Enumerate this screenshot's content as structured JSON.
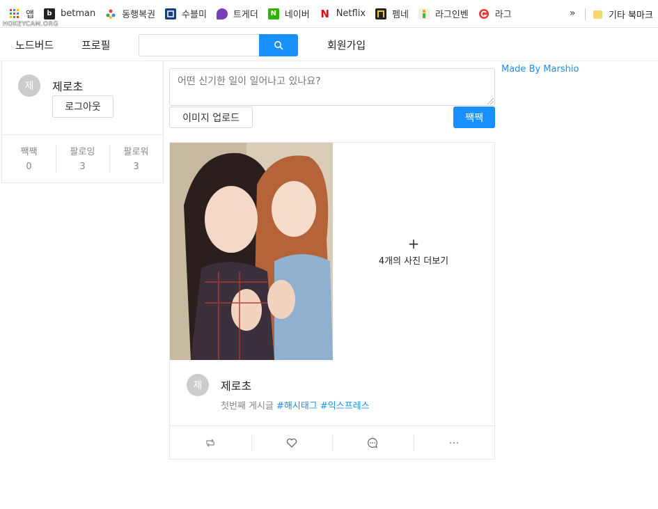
{
  "bookmarks": {
    "items": [
      {
        "label": "앱",
        "icon": "apps-grid-icon",
        "color": "#e94235"
      },
      {
        "label": "betman",
        "icon": "betman-icon",
        "color": "#222222"
      },
      {
        "label": "동행복권",
        "icon": "lottery-icon",
        "color": "#e94235"
      },
      {
        "label": "수블미",
        "icon": "sublime-icon",
        "color": "#1a3a8a"
      },
      {
        "label": "트게더",
        "icon": "twitch-icon",
        "color": "#7b3fb5"
      },
      {
        "label": "네이버",
        "icon": "naver-icon",
        "color": "#2db400"
      },
      {
        "label": "Netflix",
        "icon": "netflix-icon",
        "color": "#e50914"
      },
      {
        "label": "펨네",
        "icon": "fmkorea-icon",
        "color": "#222222"
      },
      {
        "label": "라그인벤",
        "icon": "inven-icon",
        "color": "#4caf50"
      },
      {
        "label": "라그",
        "icon": "ragnarok-icon",
        "color": "#e53935"
      }
    ],
    "overflow": "»",
    "other": "기타 북마크"
  },
  "watermark": "HOKEYCAM.ORG",
  "nav": {
    "home": "노드버드",
    "profile": "프로필",
    "search_value": "",
    "signup": "회원가입"
  },
  "profile": {
    "avatar": "제",
    "nickname": "제로초",
    "logout": "로그아웃",
    "stats": [
      {
        "label": "짹짹",
        "value": "0"
      },
      {
        "label": "팔로잉",
        "value": "3"
      },
      {
        "label": "팔로워",
        "value": "3"
      }
    ]
  },
  "composer": {
    "placeholder": "어떤 신기한 일이 일어나고 있나요?",
    "upload": "이미지 업로드",
    "submit": "짹짹"
  },
  "made_by": "Made By Marshio",
  "post": {
    "more_plus": "+",
    "more_label": "4개의 사진 더보기",
    "avatar": "제",
    "author": "제로초",
    "text": "첫번째 게시글 ",
    "tags": [
      "#해시태그",
      "#익스프레스"
    ]
  },
  "colors": {
    "primary": "#1890ff",
    "border": "#e8e8e8"
  }
}
